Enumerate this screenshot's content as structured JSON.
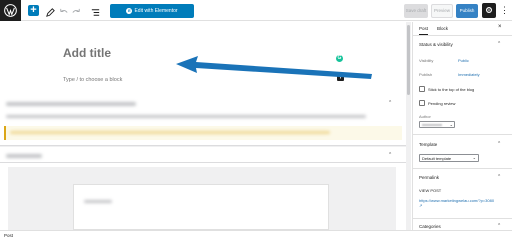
{
  "toolbar": {
    "elementor_label": "Edit with Elementor",
    "save_draft_label": "Save draft",
    "preview_label": "Preview",
    "publish_label": "Publish"
  },
  "editor": {
    "title_placeholder": "Add title",
    "block_placeholder": "Type / to choose a block"
  },
  "statusbar": {
    "breadcrumb": "Post"
  },
  "sidebar": {
    "tabs": [
      "Post",
      "Block"
    ],
    "status_title": "Status & visibility",
    "visibility_label": "Visibility",
    "visibility_value": "Public",
    "publish_label": "Publish",
    "publish_value": "Immediately",
    "stick_label": "Stick to the top of the blog",
    "pending_label": "Pending review",
    "author_label": "Author",
    "template_title": "Template",
    "template_value": "Default template",
    "permalink_title": "Permalink",
    "view_post_label": "VIEW POST",
    "permalink_url": "https://www.marketingwelau.com/?p=3080",
    "categories_title": "Categories"
  },
  "colors": {
    "accent": "#007cba",
    "arrow": "#1a73b8",
    "grammarly": "#15c39a"
  }
}
